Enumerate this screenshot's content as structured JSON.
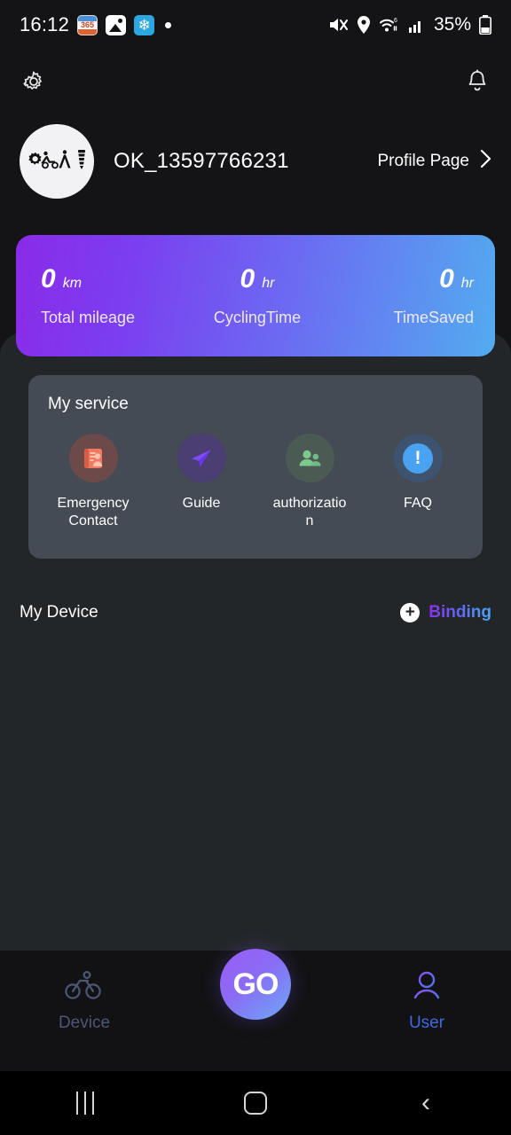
{
  "status_bar": {
    "time": "16:12",
    "notification_icons": [
      "calendar-365-icon",
      "photos-icon",
      "snowflake-icon",
      "dot-indicator"
    ],
    "calendar_label": "365",
    "snowflake_glyph": "❄",
    "system_icons": [
      "mute-icon",
      "location-icon",
      "wifi-icon",
      "signal-icon"
    ],
    "battery_percent": "35%"
  },
  "header": {
    "settings_icon": "gear-icon",
    "notifications_icon": "bell-icon",
    "username": "OK_13597766231",
    "profile_link": "Profile Page",
    "profile_chevron": "chevron-right-icon",
    "avatar_icons": [
      "gear-icon",
      "scooter-icon",
      "compass-icon",
      "screw-icon"
    ]
  },
  "stats": {
    "items": [
      {
        "value": "0",
        "unit": "km",
        "label": "Total mileage"
      },
      {
        "value": "0",
        "unit": "hr",
        "label": "CyclingTime"
      },
      {
        "value": "0",
        "unit": "hr",
        "label": "TimeSaved"
      }
    ],
    "gradient_from": "#8A2BE8",
    "gradient_to": "#53ABF0"
  },
  "service": {
    "title": "My service",
    "items": [
      {
        "label": "Emergency Contact",
        "icon": "contact-book-icon",
        "bg": "#6C4A49",
        "fg": "#F07A60"
      },
      {
        "label": "Guide",
        "icon": "paper-plane-icon",
        "bg": "#4A3E73",
        "fg": "#7C4DF5"
      },
      {
        "label": "authorization",
        "icon": "people-icon",
        "bg": "#4B5A52",
        "fg": "#7CC98E"
      },
      {
        "label": "FAQ",
        "icon": "exclamation-circle-icon",
        "bg": "#3E5370",
        "fg": "#4AA3F0"
      }
    ]
  },
  "device_section": {
    "title": "My Device",
    "binding_label": "Binding",
    "binding_icon": "plus-circle-icon",
    "binding_gradient_from": "#8B2FE8",
    "binding_gradient_to": "#4AA8F2"
  },
  "bottom_nav": {
    "tabs": [
      {
        "label": "Device",
        "icon": "bicycle-icon",
        "active": false,
        "color": "#4C5775"
      },
      {
        "label": "User",
        "icon": "user-icon",
        "active": true,
        "color": "#3D6AE0"
      }
    ],
    "center_button": {
      "label": "GO",
      "gradient_from": "#9B5CF6",
      "gradient_to": "#6BA8F5"
    }
  },
  "android_nav": {
    "recents": "recents-icon",
    "home": "home-icon",
    "back": "back-icon",
    "back_glyph": "‹"
  }
}
